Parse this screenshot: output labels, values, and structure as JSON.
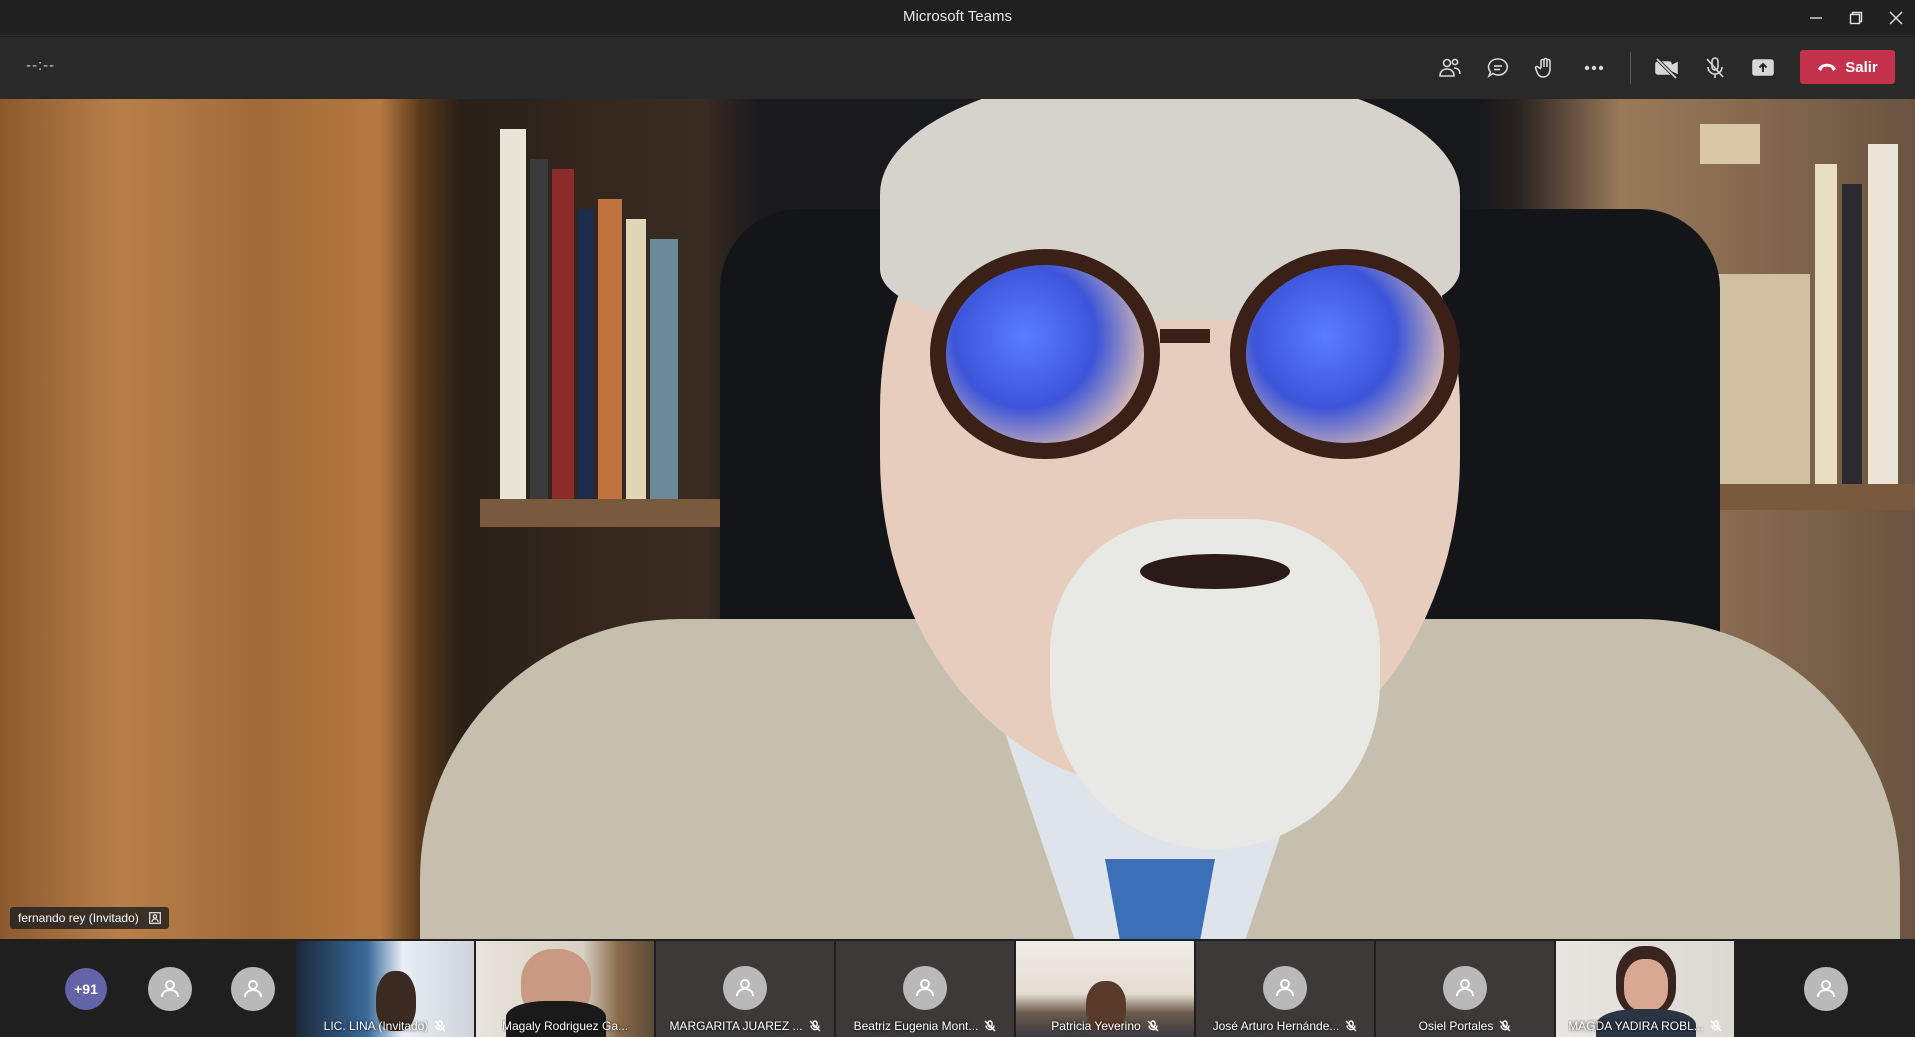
{
  "window": {
    "title": "Microsoft Teams"
  },
  "toolbar": {
    "timer": "--:--",
    "leave_label": "Salir",
    "icons": [
      "participants-icon",
      "chat-icon",
      "raise-hand-icon",
      "more-options-icon",
      "camera-off-icon",
      "mic-off-icon",
      "share-screen-icon"
    ]
  },
  "stage": {
    "speaker_name": "fernando rey (Invitado)"
  },
  "participants": {
    "overflow_count": "+91",
    "tiles": [
      {
        "name": "LIC. LINA (Invitado)",
        "type": "video"
      },
      {
        "name": "Magaly Rodriguez Ga...",
        "type": "video"
      },
      {
        "name": "MARGARITA JUAREZ ...",
        "type": "avatar"
      },
      {
        "name": "Beatriz Eugenia Mont...",
        "type": "avatar"
      },
      {
        "name": "Patricia Yeverino",
        "type": "video"
      },
      {
        "name": "José Arturo Hernánde...",
        "type": "avatar"
      },
      {
        "name": "Osiel Portales",
        "type": "avatar"
      },
      {
        "name": "MAGDA YADIRA ROBL...",
        "type": "video"
      }
    ]
  },
  "colors": {
    "leave_button": "#c4314b",
    "overflow_badge": "#6264a7",
    "titlebar": "#202020",
    "toolbar": "#292929"
  }
}
